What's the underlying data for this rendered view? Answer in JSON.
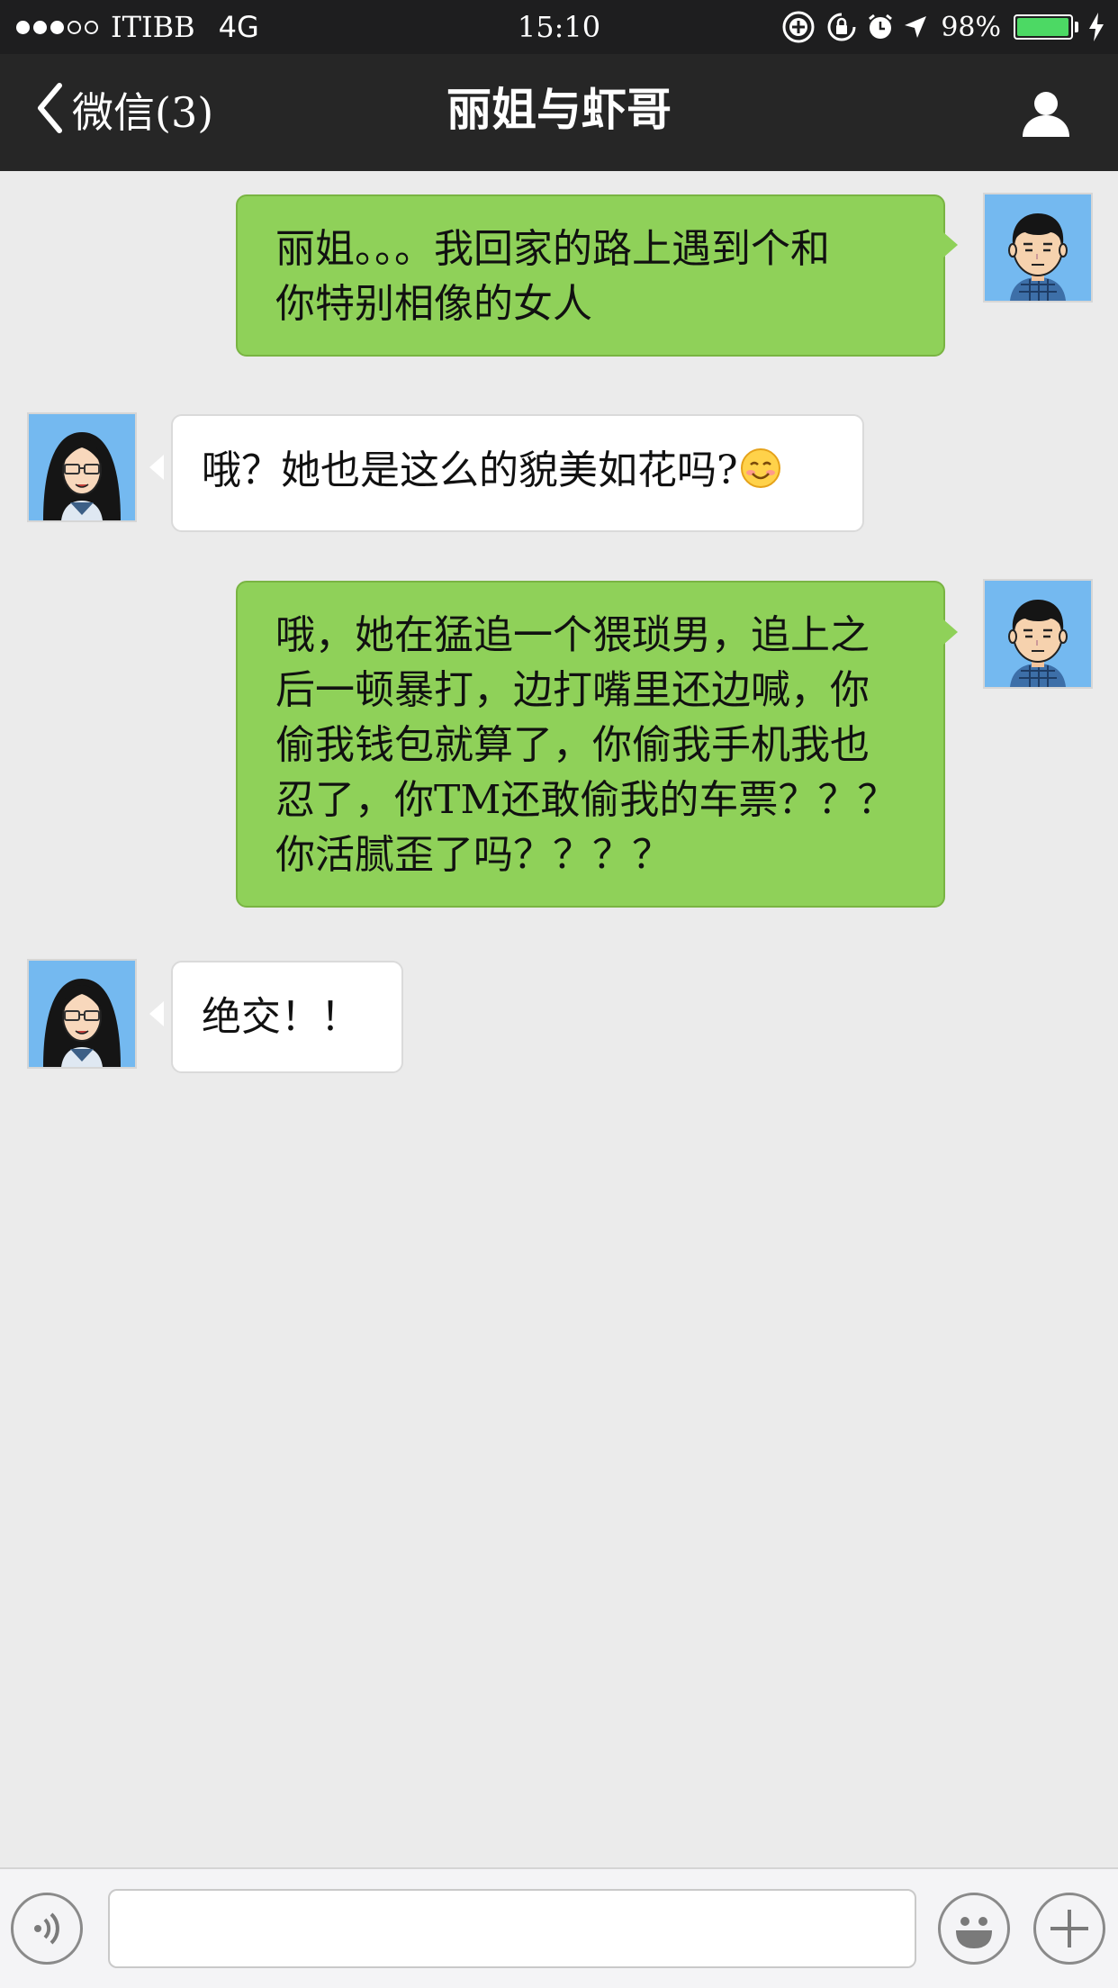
{
  "status_bar": {
    "carrier": "ITIBB",
    "network": "4G",
    "time": "15:10",
    "battery": "98%",
    "battery_level": 0.98
  },
  "nav": {
    "back_label": "微信(3)",
    "title": "丽姐与虾哥"
  },
  "messages": [
    {
      "sender": "me",
      "text_lines": [
        "丽姐。。。我回家的路上遇到个和",
        "你特别相像的女人"
      ]
    },
    {
      "sender": "other",
      "text": "哦？她也是这么的貌美如花吗?",
      "emoji": "smiling-face-emoji"
    },
    {
      "sender": "me",
      "text_lines": [
        "哦，她在猛追一个猥琐男，追上之",
        "后一顿暴打，边打嘴里还边喊，你",
        "偷我钱包就算了，你偷我手机我也",
        "忍了，你TM还敢偷我的车票？？？",
        "你活腻歪了吗？？？？"
      ]
    },
    {
      "sender": "other",
      "text": "绝交！！"
    }
  ],
  "input": {
    "value": "",
    "placeholder": ""
  },
  "colors": {
    "sent_bubble": "#8fd159",
    "received_bubble": "#ffffff",
    "chat_background": "#ebebeb",
    "nav_background": "#262626",
    "battery_fill": "#4cd964"
  },
  "icons": {
    "back": "chevron-left-icon",
    "profile": "person-icon",
    "voice": "voice-icon",
    "emoji": "smiley-icon",
    "more": "plus-icon"
  }
}
